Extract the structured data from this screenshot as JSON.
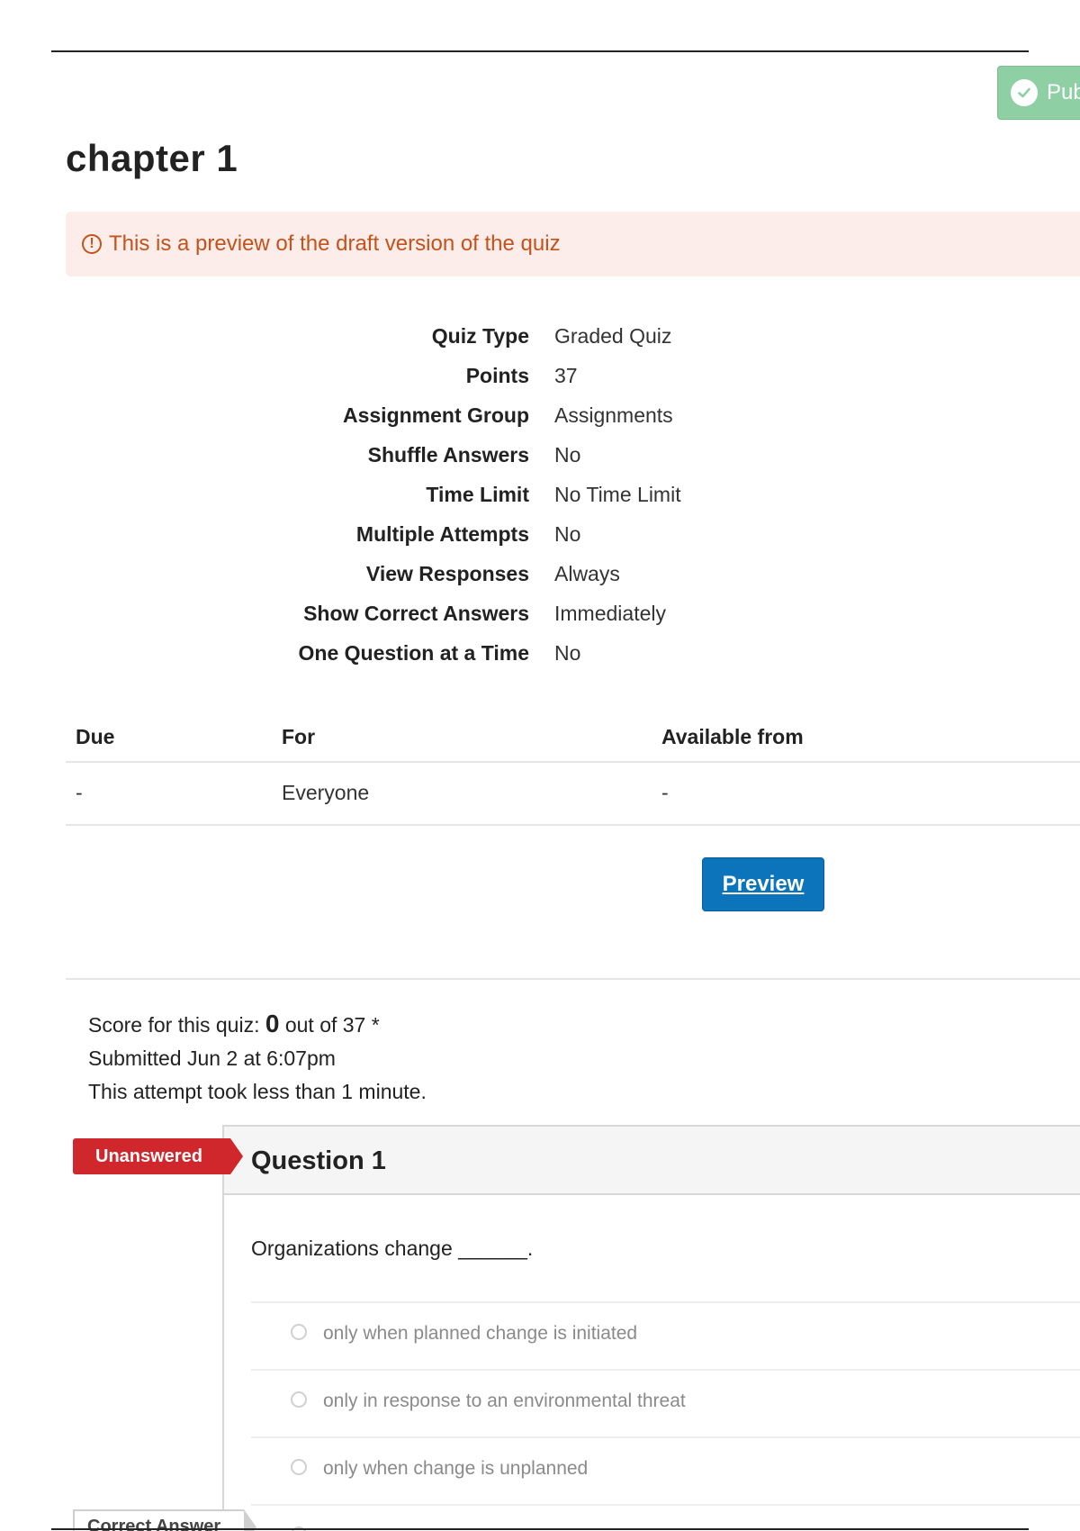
{
  "header": {
    "publish_label": "Pub",
    "title": "chapter 1"
  },
  "alert": {
    "message": "This is a preview of the draft version of the quiz",
    "icon": "alert-circle-icon"
  },
  "details": [
    {
      "label": "Quiz Type",
      "value": "Graded Quiz"
    },
    {
      "label": "Points",
      "value": "37"
    },
    {
      "label": "Assignment Group",
      "value": "Assignments"
    },
    {
      "label": "Shuffle Answers",
      "value": "No"
    },
    {
      "label": "Time Limit",
      "value": "No Time Limit"
    },
    {
      "label": "Multiple Attempts",
      "value": "No"
    },
    {
      "label": "View Responses",
      "value": "Always"
    },
    {
      "label": "Show Correct Answers",
      "value": "Immediately"
    },
    {
      "label": "One Question at a Time",
      "value": "No"
    }
  ],
  "dates": {
    "headers": [
      "Due",
      "For",
      "Available from"
    ],
    "row": [
      "-",
      "Everyone",
      "-"
    ]
  },
  "preview_button": "Preview",
  "score": {
    "prefix": "Score for this quiz:",
    "score": "0",
    "suffix": "out of 37 *",
    "submitted": "Submitted Jun 2 at 6:07pm",
    "duration": "This attempt took less than 1 minute."
  },
  "question": {
    "status": "Unanswered",
    "title": "Question 1",
    "text": "Organizations change ______.",
    "answers": [
      "only when planned change is initiated",
      "only in response to an environmental threat",
      "only when change is unplanned"
    ],
    "correct_label": "Correct Answer"
  },
  "colors": {
    "publish": "#8fcfa4",
    "alert_bg": "#fcecea",
    "alert_text": "#c45219",
    "primary_button": "#0b74bb",
    "unanswered_badge": "#d0272d"
  }
}
